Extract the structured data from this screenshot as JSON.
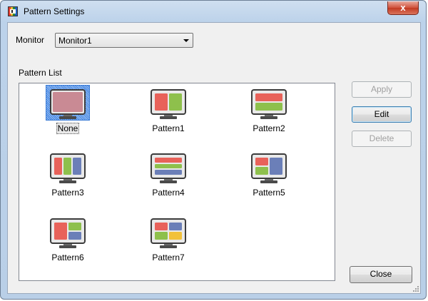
{
  "window": {
    "title": "Pattern Settings",
    "close_glyph": "x"
  },
  "monitor": {
    "label": "Monitor",
    "selected": "Monitor1"
  },
  "pattern_list": {
    "label": "Pattern List",
    "selected": "None",
    "items": [
      {
        "name": "None",
        "layout": "none"
      },
      {
        "name": "Pattern1",
        "layout": "two-columns"
      },
      {
        "name": "Pattern2",
        "layout": "two-rows"
      },
      {
        "name": "Pattern3",
        "layout": "three-columns"
      },
      {
        "name": "Pattern4",
        "layout": "three-rows"
      },
      {
        "name": "Pattern5",
        "layout": "left-stack-right-tall"
      },
      {
        "name": "Pattern6",
        "layout": "left-tall-right-stack"
      },
      {
        "name": "Pattern7",
        "layout": "four-grid"
      }
    ]
  },
  "buttons": {
    "apply": "Apply",
    "edit": "Edit",
    "delete": "Delete",
    "close": "Close"
  },
  "colors": {
    "red": "#e8625a",
    "green": "#8ec04c",
    "blue": "#6b7fb8",
    "yellow": "#f2c13a",
    "none_fill": "#c98a94",
    "bezel": "#3c3c3c"
  }
}
